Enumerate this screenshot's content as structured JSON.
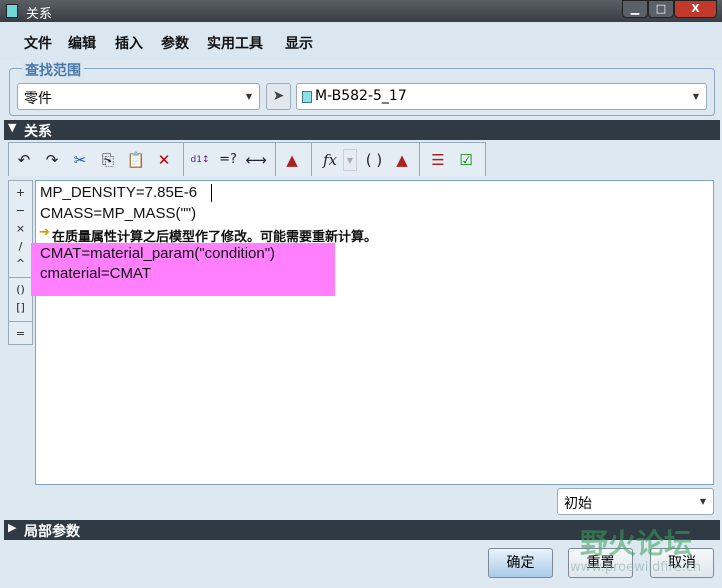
{
  "window": {
    "title": "关系",
    "minimize": "▁",
    "maximize": "□",
    "close": "X"
  },
  "menu": [
    "文件",
    "编辑",
    "插入",
    "参数",
    "实用工具",
    "显示"
  ],
  "lookin": {
    "label": "查找范围",
    "type_value": "零件",
    "model_value": "M-B582-5_17"
  },
  "relations": {
    "header": "关系",
    "lines": [
      "MP_DENSITY=7.85E-6",
      "CMASS=MP_MASS(\"\")",
      "在质量属性计算之后模型作了修改。可能需要重新计算。",
      "CMAT=material_param(\"condition\")",
      "cmaterial=CMAT"
    ],
    "side_ops": [
      "+",
      "−",
      "×",
      "/",
      "^",
      "()",
      "[]",
      "="
    ],
    "sort_value": "初始"
  },
  "local_params": {
    "header": "局部参数"
  },
  "buttons": {
    "ok": "确定",
    "reset": "重置",
    "cancel": "取消"
  },
  "watermark": {
    "text": "野火论坛",
    "url": "www.proewildfire.cn"
  }
}
